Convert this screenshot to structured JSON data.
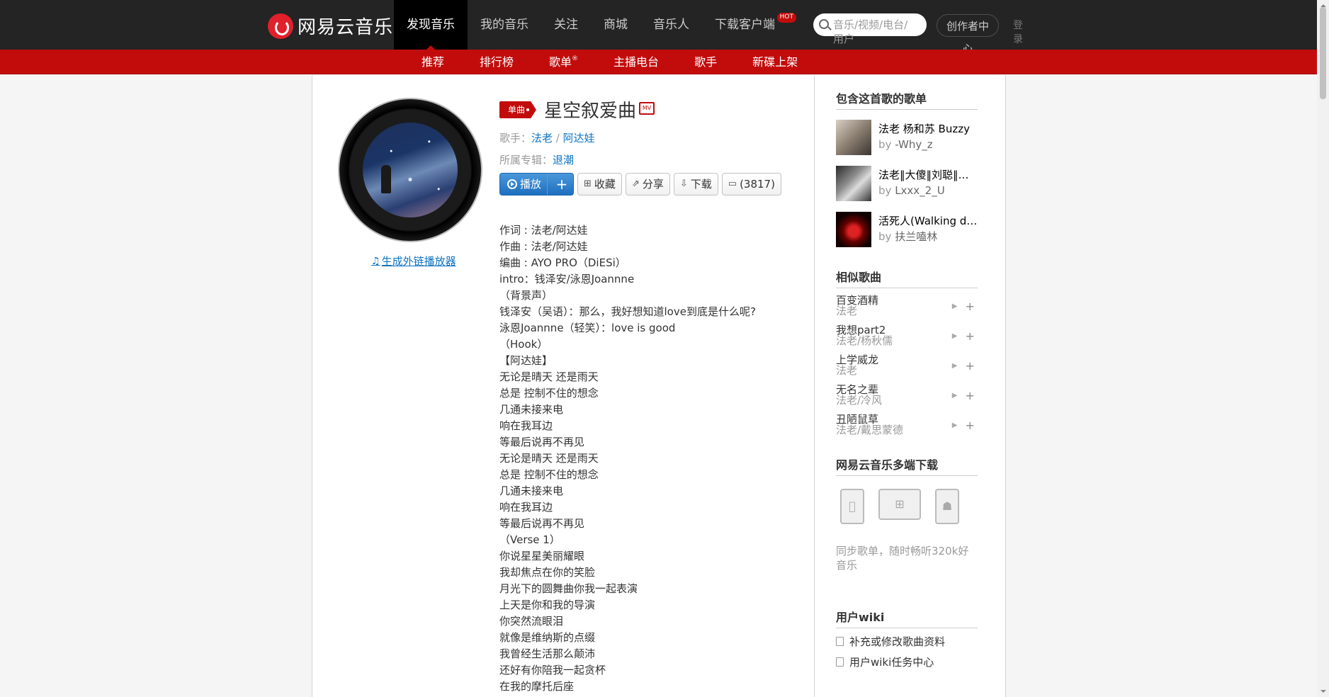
{
  "header": {
    "logo_text": "网易云音乐",
    "nav": [
      "发现音乐",
      "我的音乐",
      "关注",
      "商城",
      "音乐人",
      "下载客户端"
    ],
    "hot_badge": "HOT",
    "search_placeholder": "音乐/视频/电台/用户",
    "creator_label": "创作者中心",
    "login_label": "登录"
  },
  "subnav": [
    "推荐",
    "排行榜",
    "歌单",
    "主播电台",
    "歌手",
    "新碟上架"
  ],
  "subnav_sup": "®",
  "song": {
    "badge": "单曲",
    "title": "星空叙爱曲",
    "mv": "MV",
    "singer_label": "歌手：",
    "singers": [
      "法老",
      "阿达娃"
    ],
    "sep": " / ",
    "album_label": "所属专辑：",
    "album": "退潮",
    "ext_player_link": "生成外链播放器"
  },
  "actions": {
    "play": "播放",
    "add": "+",
    "collect": "收藏",
    "share": "分享",
    "download": "下载",
    "comments": "(3817)"
  },
  "lyrics": [
    "作词 : 法老/阿达娃",
    "作曲 : 法老/阿达娃",
    "编曲 : AYO PRO（DiESi）",
    "intro：钱泽安/泳恩Joannne",
    "（背景声）",
    "钱泽安（吴语）：那么，我好想知道love到底是什么呢?",
    "泳恩Joannne（轻笑）：love is good",
    "（Hook）",
    "【阿达娃】",
    "无论是晴天 还是雨天",
    "总是 控制不住的想念",
    "几通未接来电",
    "响在我耳边",
    "等最后说再不再见",
    "无论是晴天 还是雨天",
    "总是 控制不住的想念",
    "几通未接来电",
    "响在我耳边",
    "等最后说再不再见",
    "（Verse 1）",
    "你说星星美丽耀眼",
    "我却焦点在你的笑脸",
    "月光下的圆舞曲你我一起表演",
    "上天是你和我的导演",
    "你突然流眼泪",
    "就像是维纳斯的点缀",
    "我曾经生活那么颠沛",
    "还好有你陪我一起贪杯",
    "在我的摩托后座"
  ],
  "sidebar": {
    "playlists_title": "包含这首歌的歌单",
    "playlists": [
      {
        "name": "法老 杨和苏 Buzzy",
        "by_label": "by",
        "by": "-Why_z"
      },
      {
        "name": "法老‖大傻‖刘聪‖…",
        "by_label": "by",
        "by": "Lxxx_2_U"
      },
      {
        "name": "活死人(Walking d…",
        "by_label": "by",
        "by": "扶兰嗑林"
      }
    ],
    "similar_title": "相似歌曲",
    "similar": [
      {
        "name": "百变酒精",
        "artist": "法老"
      },
      {
        "name": "我想part2",
        "artist": "法老/杨秋儒"
      },
      {
        "name": "上学威龙",
        "artist": "法老"
      },
      {
        "name": "无名之辈",
        "artist": "法老/冷风"
      },
      {
        "name": "丑陋鼠草",
        "artist": "法老/戴思蒙德"
      }
    ],
    "download_title": "网易云音乐多端下载",
    "download_desc": "同步歌单，随时畅听320k好音乐",
    "wiki_title": "用户wiki",
    "wiki_items": [
      "补充或修改歌曲资料",
      "用户wiki任务中心"
    ]
  },
  "colors": {
    "brand_red": "#c20c0c",
    "topbar": "#242424",
    "link_blue": "#0c73c2"
  }
}
